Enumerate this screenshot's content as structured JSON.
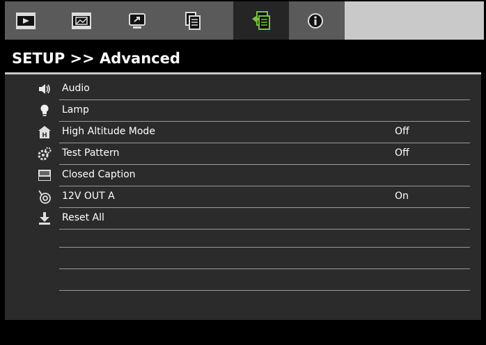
{
  "menu": {
    "tabs": [
      {
        "icon": "image-settings-icon"
      },
      {
        "icon": "display-settings-icon"
      },
      {
        "icon": "setup-basic-icon"
      },
      {
        "icon": "setup-document-icon"
      },
      {
        "icon": "setup-advanced-icon",
        "active": true
      },
      {
        "icon": "information-icon"
      }
    ],
    "title": "SETUP >> Advanced",
    "items": [
      {
        "label": "Audio",
        "value": "",
        "icon": "speaker-icon"
      },
      {
        "label": "Lamp",
        "value": "",
        "icon": "lamp-icon"
      },
      {
        "label": "High Altitude Mode",
        "value": "Off",
        "icon": "high-altitude-icon"
      },
      {
        "label": "Test Pattern",
        "value": "Off",
        "icon": "test-pattern-icon"
      },
      {
        "label": "Closed Caption",
        "value": "",
        "icon": "closed-caption-icon"
      },
      {
        "label": "12V OUT A",
        "value": "On",
        "icon": "trigger-out-icon"
      },
      {
        "label": "Reset All",
        "value": "",
        "icon": "reset-icon"
      }
    ]
  },
  "colors": {
    "panel": "#2b2b2b",
    "tab_active": "#252525",
    "tab_bar": "#5a5a5a",
    "accent_green": "#7ec23a"
  }
}
